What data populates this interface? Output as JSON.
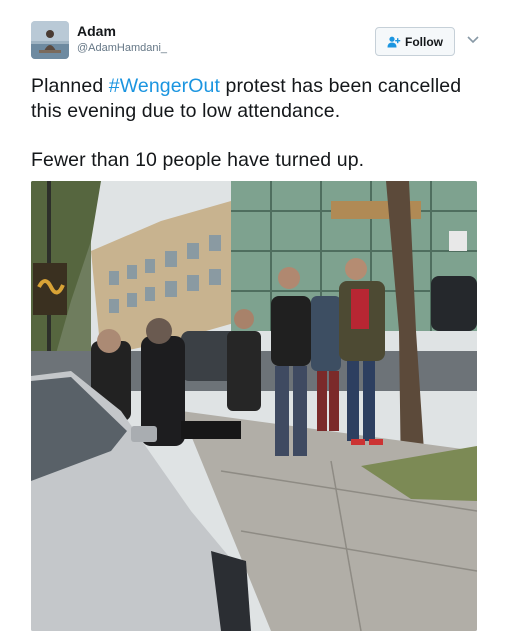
{
  "user": {
    "display_name": "Adam",
    "handle": "@AdamHamdani_"
  },
  "follow": {
    "label": "Follow",
    "icon": "person-plus-icon",
    "more_icon": "chevron-down-icon"
  },
  "tweet": {
    "text_before": "Planned ",
    "hashtag": "#WengerOut",
    "text_after": " protest has been cancelled this evening due to low attendance.",
    "text_second": "Fewer than 10 people have turned up."
  },
  "colors": {
    "link": "#1b95e0",
    "text": "#14171a",
    "secondary_text": "#657786"
  }
}
